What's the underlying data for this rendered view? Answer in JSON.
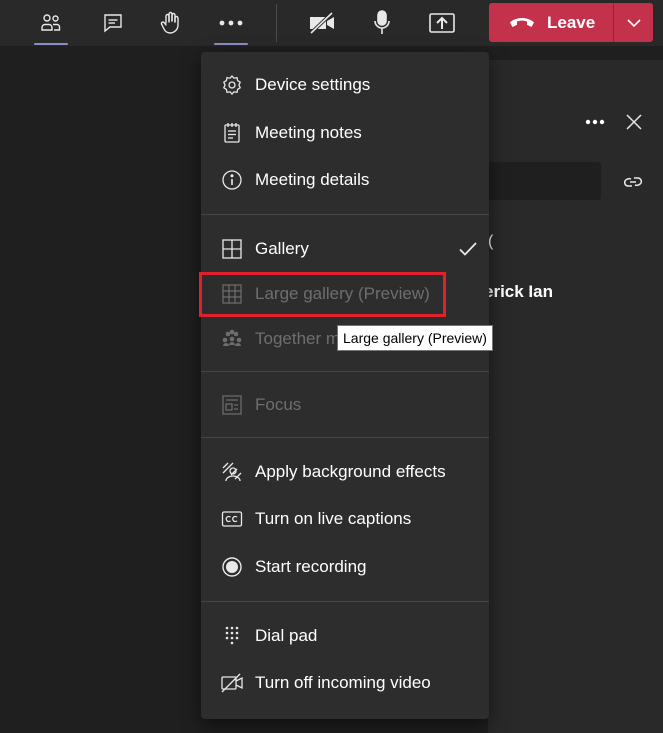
{
  "toolbar": {
    "participants_icon": "people-icon",
    "chat_icon": "chat-icon",
    "raise_hand_icon": "hand-icon",
    "more_icon": "more-icon",
    "camera_icon": "camera-off-icon",
    "mic_icon": "mic-icon",
    "share_icon": "share-icon",
    "leave_label": "Leave",
    "leave_color": "#c4314b"
  },
  "side_panel": {
    "check_tail": "(",
    "participant_name": "erick Ian"
  },
  "menu": {
    "items": [
      {
        "label": "Device settings",
        "icon": "gear-icon"
      },
      {
        "label": "Meeting notes",
        "icon": "notes-icon"
      },
      {
        "label": "Meeting details",
        "icon": "info-icon"
      },
      {
        "label": "Gallery",
        "icon": "gallery-icon",
        "checked": true
      },
      {
        "label": "Large gallery (Preview)",
        "icon": "large-gallery-icon",
        "disabled": true
      },
      {
        "label": "Together mode",
        "icon": "together-mode-icon",
        "disabled": true
      },
      {
        "label": "Focus",
        "icon": "focus-icon",
        "disabled": true
      },
      {
        "label": "Apply background effects",
        "icon": "background-effects-icon"
      },
      {
        "label": "Turn on live captions",
        "icon": "captions-icon"
      },
      {
        "label": "Start recording",
        "icon": "record-icon"
      },
      {
        "label": "Dial pad",
        "icon": "dialpad-icon"
      },
      {
        "label": "Turn off incoming video",
        "icon": "video-off-icon"
      }
    ],
    "together_visible": "Together m"
  },
  "tooltip": {
    "text": "Large gallery (Preview)"
  },
  "colors": {
    "accent": "#8b8cc7",
    "highlight": "#e0202c"
  }
}
